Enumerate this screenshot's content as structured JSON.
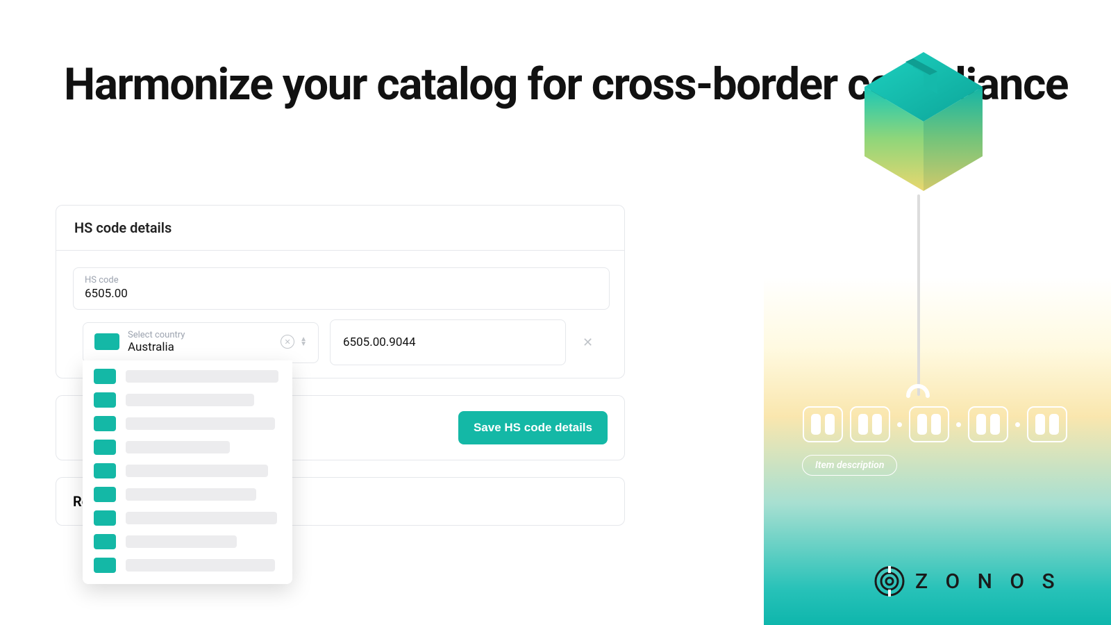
{
  "headline": "Harmonize your catalog for cross-border compliance",
  "card_title": "HS code details",
  "hs_code": {
    "label": "HS code",
    "value": "6505.00"
  },
  "country": {
    "label": "Select country",
    "value": "Australia"
  },
  "extended_code": "6505.00.9044",
  "save_button": "Save HS code details",
  "partial_label": "Re",
  "item_desc_label": "Item description",
  "brand": "Z O N O S",
  "colors": {
    "accent": "#14b8a6"
  }
}
